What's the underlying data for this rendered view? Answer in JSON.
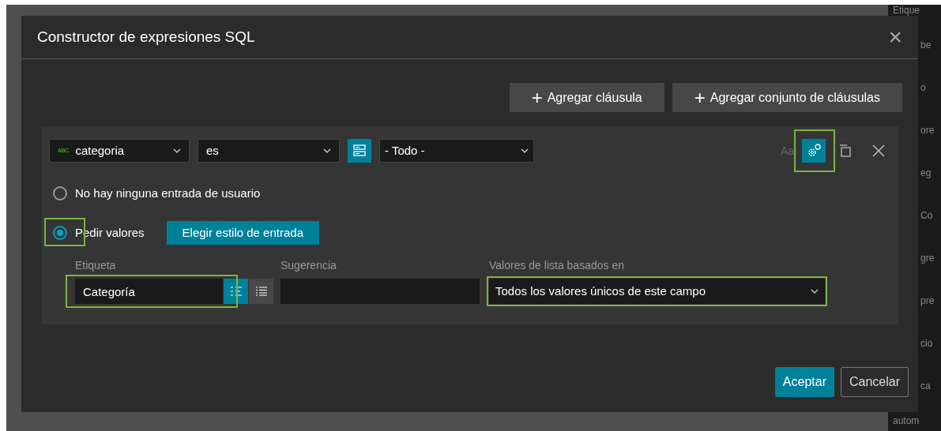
{
  "background_panel": {
    "fragments": [
      "Etique",
      "be",
      "o",
      "ore",
      "eg",
      "Co",
      "gre",
      "pre",
      "cio",
      "ca",
      "autom"
    ]
  },
  "dialog": {
    "title": "Constructor de expresiones SQL",
    "close": "×"
  },
  "toolbar": {
    "buttons": [
      {
        "icon": "+",
        "label": "Agregar cláusula"
      },
      {
        "icon": "+",
        "label": "Agregar conjunto de cláusulas"
      }
    ]
  },
  "clause": {
    "field": {
      "type_badge": "ABC",
      "value": "categoria"
    },
    "operator": {
      "value": "es"
    },
    "value_select": {
      "value": "- Todo -"
    },
    "case_toggle": {
      "label": "Aa",
      "disabled": true
    },
    "actions": {
      "settings_selected": true,
      "settings_highlighted": true
    },
    "input_modes": [
      {
        "label": "No hay ninguna entrada de usuario",
        "selected": false,
        "highlighted": false
      },
      {
        "label": "Pedir valores",
        "selected": true,
        "highlighted": true
      }
    ],
    "style_button": "Elegir estilo de entrada",
    "fields": {
      "label": {
        "caption": "Etiqueta",
        "value": "Categoría",
        "highlighted": true
      },
      "view_modes": [
        {
          "kind": "compact",
          "selected": true
        },
        {
          "kind": "list",
          "selected": false
        }
      ],
      "hint": {
        "caption": "Sugerencia"
      },
      "list_source": {
        "caption": "Valores de lista basados en",
        "value": "Todos los valores únicos de este campo",
        "highlighted": true
      }
    }
  },
  "footer": {
    "buttons": [
      {
        "label": "Aceptar",
        "kind": "primary"
      },
      {
        "label": "Cancelar",
        "kind": "secondary"
      }
    ]
  }
}
